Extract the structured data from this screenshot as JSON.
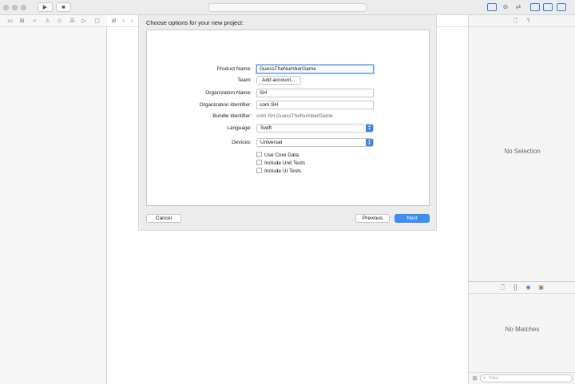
{
  "toolbar": {
    "run_glyph": "▶",
    "stop_glyph": "■",
    "icons": [
      "run-icon",
      "stop-icon",
      "standard-editor-icon",
      "assistant-editor-icon",
      "version-editor-icon",
      "navigator-toggle-icon",
      "debug-area-toggle-icon",
      "utilities-toggle-icon"
    ],
    "accent_color": "#2e7be0"
  },
  "navigator": {
    "icons": [
      "folder-icon",
      "symbol-icon",
      "find-icon",
      "issue-icon",
      "test-icon",
      "debug-icon",
      "breakpoint-icon",
      "report-icon"
    ],
    "glyphs": [
      "▭",
      "⊞",
      "⌕",
      "⚠",
      "◇",
      "☰",
      "▷",
      "▢"
    ],
    "back_glyph": "‹",
    "forward_glyph": "›"
  },
  "sheet": {
    "title": "Choose options for your new project:",
    "product_name_label": "Product Name:",
    "product_name_value": "GuessTheNumberGame",
    "team_label": "Team:",
    "team_button": "Add account...",
    "org_name_label": "Organization Name:",
    "org_name_value": "SH",
    "org_id_label": "Organization Identifier:",
    "org_id_value": "com.SH",
    "bundle_id_label": "Bundle Identifier:",
    "bundle_id_value": "com.SH.GuessTheNumberGame",
    "language_label": "Language:",
    "language_value": "Swift",
    "devices_label": "Devices:",
    "devices_value": "Universal",
    "checkboxes": [
      {
        "label": "Use Core Data",
        "checked": false
      },
      {
        "label": "Include Unit Tests",
        "checked": false
      },
      {
        "label": "Include UI Tests",
        "checked": false
      }
    ],
    "cancel_label": "Cancel",
    "previous_label": "Previous",
    "next_label": "Next",
    "primary_color": "#3f8ef0"
  },
  "inspector": {
    "file_glyph": "🗋",
    "help_glyph": "?",
    "no_selection": "No Selection",
    "library_glyphs": [
      "🗋",
      "{}",
      "◉",
      "▣"
    ],
    "no_matches": "No Matches",
    "filter_placeholder": "Filter"
  }
}
